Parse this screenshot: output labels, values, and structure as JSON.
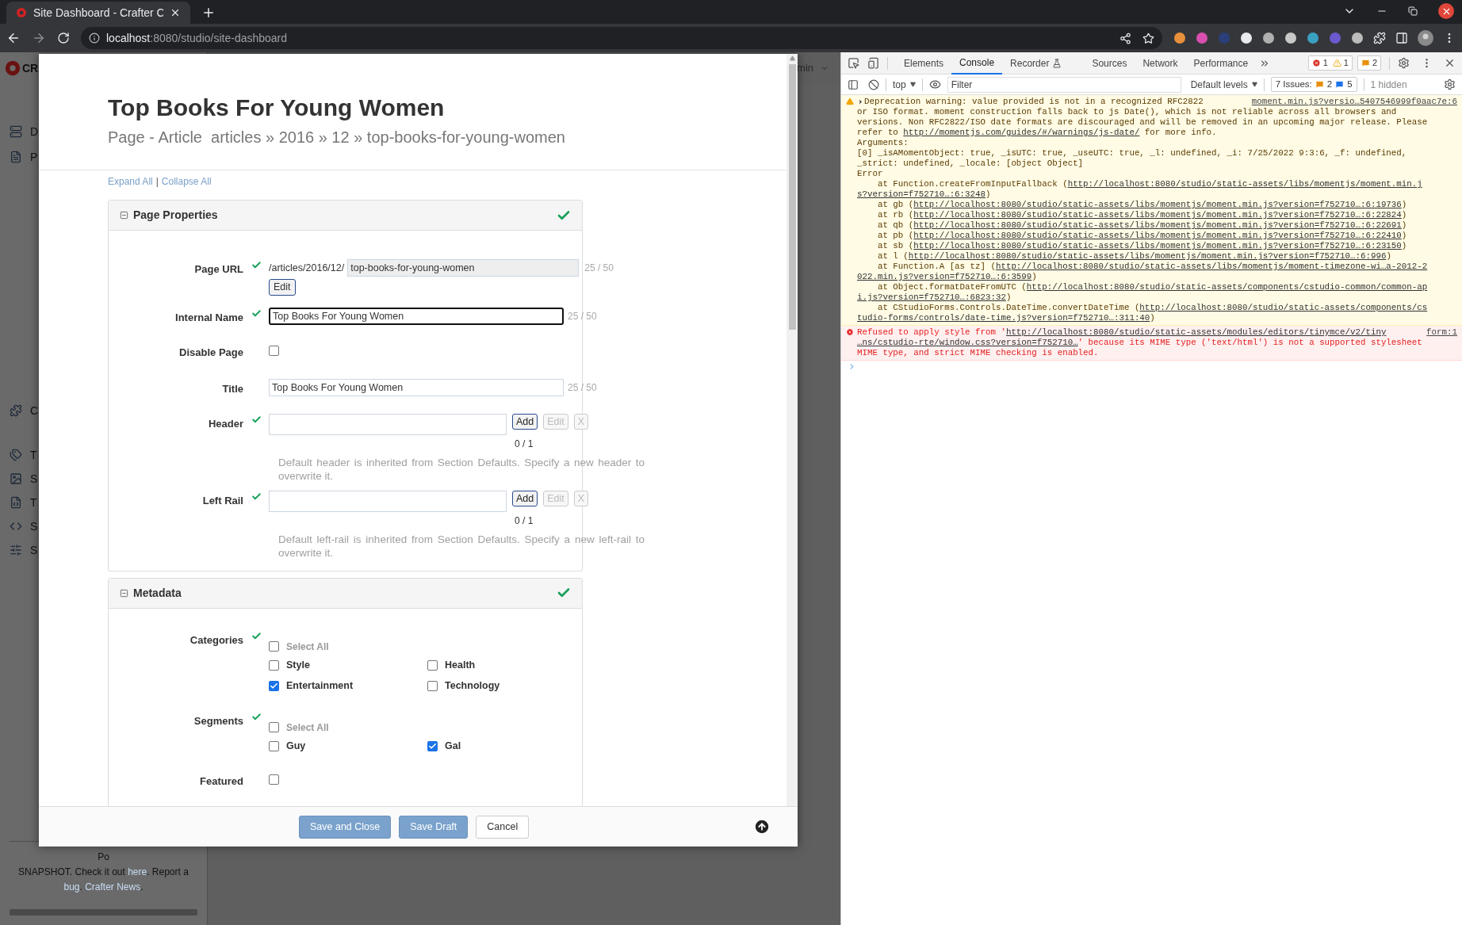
{
  "browser": {
    "tab_title": "Site Dashboard - Crafter C",
    "url_host": "localhost",
    "url_path": ":8080/studio/site-dashboard"
  },
  "site": {
    "logo": "CR",
    "user_menu": "min",
    "sidebar": [
      {
        "label": "D",
        "kind": "dashboard"
      },
      {
        "label": "P",
        "kind": "pages"
      },
      {
        "label": "C",
        "kind": "components"
      },
      {
        "label": "T",
        "kind": "taxonomy"
      },
      {
        "label": "S",
        "kind": "static"
      },
      {
        "label": "T",
        "kind": "templates"
      },
      {
        "label": "S",
        "kind": "scripts"
      },
      {
        "label": "S",
        "kind": "settings"
      }
    ],
    "footer": [
      {
        "text": "Po",
        "link": false,
        "kind": "line"
      },
      {
        "text": "SNAPSHOT. Check it out ",
        "link": false,
        "kind": "inline"
      },
      {
        "text": "here",
        "link": true,
        "kind": "inline"
      },
      {
        "text": ". Report a",
        "link": false,
        "kind": "line"
      },
      {
        "text": "bug",
        "link": true,
        "kind": "inline"
      },
      {
        "text": ". ",
        "link": false,
        "kind": "inline"
      },
      {
        "text": "Crafter News",
        "link": true,
        "kind": "inline"
      },
      {
        "text": ".",
        "link": false,
        "kind": "line"
      }
    ]
  },
  "modal": {
    "title": "Top Books For Young Women",
    "breadcrumb": "Page - Article  articles » 2016 » 12 » top-books-for-young-women",
    "expand_all": "Expand All",
    "separator": "|",
    "collapse_all": "Collapse All",
    "sections": [
      {
        "title": "Page Properties",
        "valid": true,
        "fields": [
          {
            "kind": "url",
            "label": "Page URL",
            "valid": true,
            "prefix": "/articles/2016/12/",
            "value": "top-books-for-young-women",
            "counter": "25 / 50",
            "button": "Edit"
          },
          {
            "kind": "text",
            "label": "Internal Name",
            "valid": true,
            "value": "Top Books For Young Women",
            "counter": "25 / 50",
            "focused": true
          },
          {
            "kind": "checkbox",
            "label": "Disable Page",
            "valid": false,
            "checked": false
          },
          {
            "kind": "text",
            "label": "Title",
            "valid": false,
            "value": "Top Books For Young Women",
            "counter": "25 / 50",
            "focused": false
          },
          {
            "kind": "node_selector",
            "label": "Header",
            "valid": true,
            "buttons": [
              {
                "label": "Add",
                "disabled": false
              },
              {
                "label": "Edit",
                "disabled": true
              },
              {
                "label": "X",
                "disabled": true
              }
            ],
            "count": "0 / 1",
            "help": "Default header is inherited from Section Defaults. Specify a new header to overwrite it."
          },
          {
            "kind": "node_selector",
            "label": "Left Rail",
            "valid": true,
            "buttons": [
              {
                "label": "Add",
                "disabled": false
              },
              {
                "label": "Edit",
                "disabled": true
              },
              {
                "label": "X",
                "disabled": true
              }
            ],
            "count": "0 / 1",
            "help": "Default left-rail is inherited from Section Defaults. Specify a new left-rail to overwrite it."
          }
        ]
      },
      {
        "title": "Metadata",
        "valid": true,
        "fields": [
          {
            "kind": "checkgroup",
            "label": "Categories",
            "valid": true,
            "select_all": {
              "label": "Select All",
              "checked": false
            },
            "options": [
              {
                "label": "Style",
                "checked": false
              },
              {
                "label": "Health",
                "checked": false
              },
              {
                "label": "Entertainment",
                "checked": true
              },
              {
                "label": "Technology",
                "checked": false
              }
            ]
          },
          {
            "kind": "checkgroup",
            "label": "Segments",
            "valid": true,
            "select_all": {
              "label": "Select All",
              "checked": false
            },
            "options": [
              {
                "label": "Guy",
                "checked": false
              },
              {
                "label": "Gal",
                "checked": true
              }
            ]
          },
          {
            "kind": "checkbox",
            "label": "Featured",
            "valid": false,
            "checked": false
          }
        ]
      }
    ],
    "footer_buttons": [
      {
        "label": "Save and Close",
        "kind": "primary"
      },
      {
        "label": "Save Draft",
        "kind": "primary"
      },
      {
        "label": "Cancel",
        "kind": "default"
      }
    ]
  },
  "devtools": {
    "tabs": [
      {
        "label": "Elements",
        "selected": false,
        "kind": "plain"
      },
      {
        "label": "Console",
        "selected": true,
        "kind": "plain"
      },
      {
        "label": "Recorder",
        "selected": false,
        "kind": "experimental"
      },
      {
        "label": "Sources",
        "selected": false,
        "kind": "plain"
      },
      {
        "label": "Network",
        "selected": false,
        "kind": "plain"
      },
      {
        "label": "Performance",
        "selected": false,
        "kind": "plain"
      }
    ],
    "error_count": "1",
    "warning_count": "1",
    "issue_count": "2",
    "context": "top",
    "filter_placeholder": "Filter",
    "levels": "Default levels",
    "issues_label": "7 Issues:",
    "issues_warn": "2",
    "issues_info": "5",
    "hidden": "1 hidden",
    "messages": [
      {
        "kind": "warning",
        "source": "moment.min.js?versio…5407546999f0aac7e:6",
        "lines": [
          [
            {
              "text": "Deprecation warning: value provided is not in a recognized RFC2822",
              "link": false
            }
          ],
          [
            {
              "text": "or ISO format. moment construction falls back to js Date(), which is not reliable across all browsers and",
              "link": false
            }
          ],
          [
            {
              "text": "versions. Non RFC2822/ISO date formats are discouraged and will be removed in an upcoming major release. Please",
              "link": false
            }
          ],
          [
            {
              "text": "refer to ",
              "link": false
            },
            {
              "text": "http://momentjs.com/guides/#/warnings/js-date/",
              "link": true
            },
            {
              "text": " for more info.",
              "link": false
            }
          ],
          [
            {
              "text": "Arguments:",
              "link": false
            }
          ],
          [
            {
              "text": "[0] _isAMomentObject: true, _isUTC: true, _useUTC: true, _l: undefined, _i: 7/25/2022 9:3:6, _f: undefined,",
              "link": false
            }
          ],
          [
            {
              "text": "_strict: undefined, _locale: [object Object]",
              "link": false
            }
          ],
          [
            {
              "text": "Error",
              "link": false
            }
          ],
          [
            {
              "text": "    at Function.createFromInputFallback (",
              "link": false
            },
            {
              "text": "http://localhost:8080/studio/static-assets/libs/momentjs/moment.min.j",
              "link": true
            }
          ],
          [
            {
              "text": "s?version=f752710…:6:3248",
              "link": true
            },
            {
              "text": ")",
              "link": false
            }
          ],
          [
            {
              "text": "    at gb (",
              "link": false
            },
            {
              "text": "http://localhost:8080/studio/static-assets/libs/momentjs/moment.min.js?version=f752710…:6:19736",
              "link": true
            },
            {
              "text": ")",
              "link": false
            }
          ],
          [
            {
              "text": "    at rb (",
              "link": false
            },
            {
              "text": "http://localhost:8080/studio/static-assets/libs/momentjs/moment.min.js?version=f752710…:6:22824",
              "link": true
            },
            {
              "text": ")",
              "link": false
            }
          ],
          [
            {
              "text": "    at qb (",
              "link": false
            },
            {
              "text": "http://localhost:8080/studio/static-assets/libs/momentjs/moment.min.js?version=f752710…:6:22691",
              "link": true
            },
            {
              "text": ")",
              "link": false
            }
          ],
          [
            {
              "text": "    at pb (",
              "link": false
            },
            {
              "text": "http://localhost:8080/studio/static-assets/libs/momentjs/moment.min.js?version=f752710…:6:22410",
              "link": true
            },
            {
              "text": ")",
              "link": false
            }
          ],
          [
            {
              "text": "    at sb (",
              "link": false
            },
            {
              "text": "http://localhost:8080/studio/static-assets/libs/momentjs/moment.min.js?version=f752710…:6:23150",
              "link": true
            },
            {
              "text": ")",
              "link": false
            }
          ],
          [
            {
              "text": "    at l (",
              "link": false
            },
            {
              "text": "http://localhost:8080/studio/static-assets/libs/momentjs/moment.min.js?version=f752710…:6:996",
              "link": true
            },
            {
              "text": ")",
              "link": false
            }
          ],
          [
            {
              "text": "    at Function.A [as tz] (",
              "link": false
            },
            {
              "text": "http://localhost:8080/studio/static-assets/libs/momentjs/moment-timezone-wi…a-2012-2",
              "link": true
            }
          ],
          [
            {
              "text": "022.min.js?version=f752710…:6:3599",
              "link": true
            },
            {
              "text": ")",
              "link": false
            }
          ],
          [
            {
              "text": "    at Object.formatDateFromUTC (",
              "link": false
            },
            {
              "text": "http://localhost:8080/studio/static-assets/components/cstudio-common/common-ap",
              "link": true
            }
          ],
          [
            {
              "text": "i.js?version=f752710…:6823:32",
              "link": true
            },
            {
              "text": ")",
              "link": false
            }
          ],
          [
            {
              "text": "    at CStudioForms.Controls.DateTime.convertDateTime (",
              "link": false
            },
            {
              "text": "http://localhost:8080/studio/static-assets/components/cs",
              "link": true
            }
          ],
          [
            {
              "text": "tudio-forms/controls/date-time.js?version=f752710…:311:40",
              "link": true
            },
            {
              "text": ")",
              "link": false
            }
          ]
        ]
      },
      {
        "kind": "error",
        "source": "form:1",
        "lines": [
          [
            {
              "text": "Refused to apply style from '",
              "link": false
            },
            {
              "text": "http://localhost:8080/studio/static-assets/modules/editors/tinymce/v2/tiny",
              "link": true
            }
          ],
          [
            {
              "text": "…ns/cstudio-rte/window.css?version=f752710…",
              "link": true
            },
            {
              "text": "' because its MIME type ('text/html') is not a supported stylesheet",
              "link": false
            }
          ],
          [
            {
              "text": "MIME type, and strict MIME checking is enabled.",
              "link": false
            }
          ]
        ]
      }
    ]
  }
}
